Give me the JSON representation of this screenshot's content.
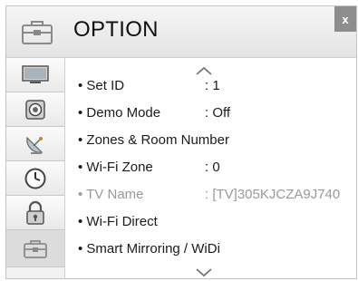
{
  "header": {
    "title": "OPTION",
    "close_label": "x"
  },
  "sidebar": {
    "items": [
      {
        "icon": "tv-picture-icon"
      },
      {
        "icon": "speaker-sound-icon"
      },
      {
        "icon": "satellite-channel-icon"
      },
      {
        "icon": "clock-time-icon"
      },
      {
        "icon": "lock-icon"
      },
      {
        "icon": "toolbox-option-icon",
        "selected": true
      }
    ]
  },
  "menu": {
    "items": [
      {
        "label": "• Set ID",
        "value": ": 1",
        "disabled": false
      },
      {
        "label": "• Demo Mode",
        "value": ": Off",
        "disabled": false
      },
      {
        "label": "• Zones & Room Number",
        "value": "",
        "disabled": false
      },
      {
        "label": "• Wi-Fi Zone",
        "value": ": 0",
        "disabled": false
      },
      {
        "label": "• TV Name",
        "value": ": [TV]305KJCZA9J740",
        "disabled": true
      },
      {
        "label": "• Wi-Fi Direct",
        "value": "",
        "disabled": false
      },
      {
        "label": "• Smart Mirroring / WiDi",
        "value": "",
        "disabled": false
      }
    ]
  },
  "colors": {
    "disabled_text": "#9a9a9a",
    "selected_tab": "#dcdcdc",
    "close_button": "#8d8d8d"
  }
}
